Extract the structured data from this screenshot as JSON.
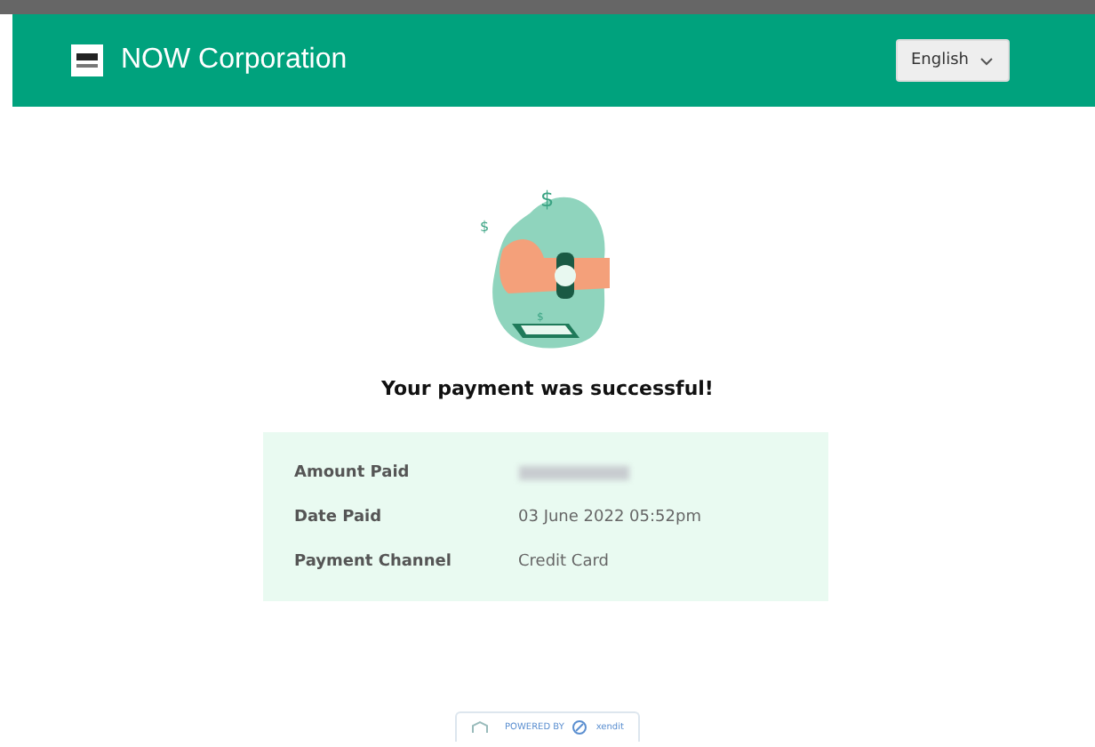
{
  "header": {
    "title": "NOW Corporation",
    "language": "English"
  },
  "illustration_signs": [
    "$",
    "$",
    "$"
  ],
  "message": "Your payment was successful!",
  "details": [
    {
      "label": "Amount Paid",
      "kind": "blurred"
    },
    {
      "label": "Date Paid",
      "kind": "text",
      "value": "03 June 2022 05:52pm"
    },
    {
      "label": "Payment Channel",
      "kind": "text",
      "value": "Credit Card"
    }
  ],
  "footer": {
    "powered_by": "POWERED BY",
    "brand": "xendit"
  }
}
